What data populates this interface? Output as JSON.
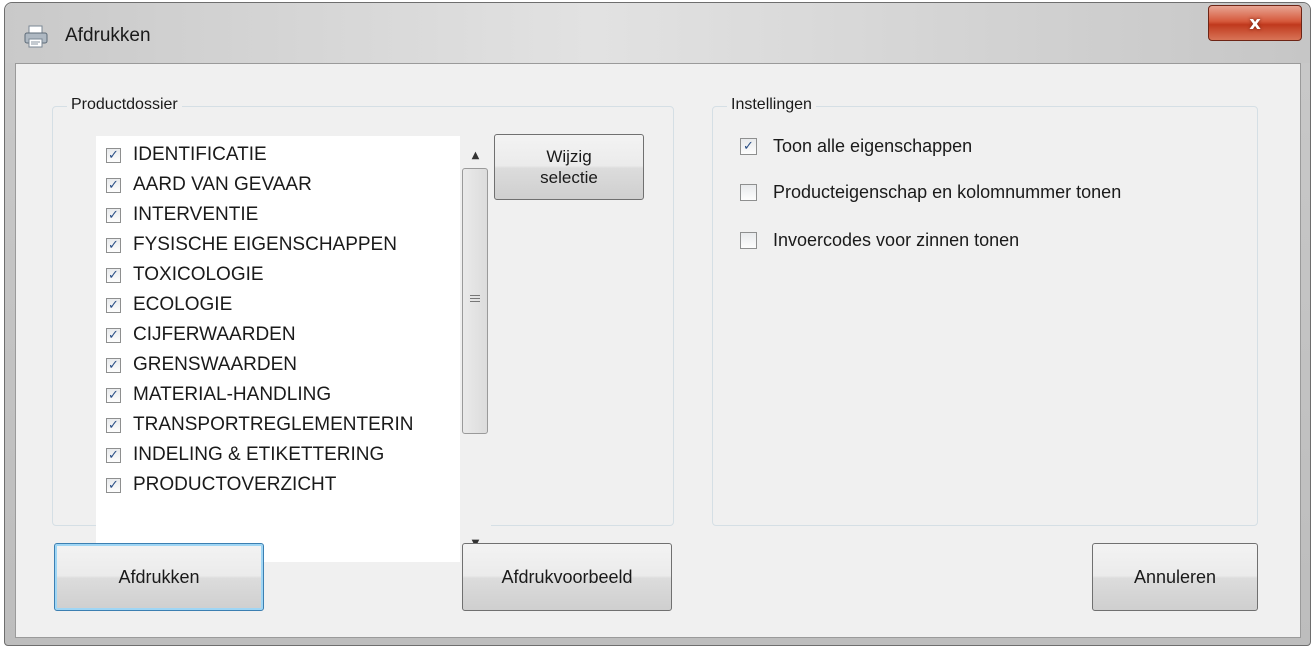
{
  "window": {
    "title": "Afdrukken",
    "close_label": "x",
    "icon": "printer-icon"
  },
  "productdossier": {
    "label": "Productdossier",
    "items": [
      {
        "label": "IDENTIFICATIE",
        "checked": true
      },
      {
        "label": "AARD VAN GEVAAR",
        "checked": true
      },
      {
        "label": "INTERVENTIE",
        "checked": true
      },
      {
        "label": "FYSISCHE EIGENSCHAPPEN",
        "checked": true
      },
      {
        "label": "TOXICOLOGIE",
        "checked": true
      },
      {
        "label": "ECOLOGIE",
        "checked": true
      },
      {
        "label": "CIJFERWAARDEN",
        "checked": true
      },
      {
        "label": "GRENSWAARDEN",
        "checked": true
      },
      {
        "label": "MATERIAL-HANDLING",
        "checked": true
      },
      {
        "label": "TRANSPORTREGLEMENTERIN",
        "checked": true
      },
      {
        "label": "INDELING & ETIKETTERING",
        "checked": true
      },
      {
        "label": "PRODUCTOVERZICHT",
        "checked": true
      }
    ],
    "wijzig_line1": "Wijzig",
    "wijzig_line2": "selectie"
  },
  "instellingen": {
    "label": "Instellingen",
    "options": [
      {
        "label": "Toon alle eigenschappen",
        "checked": true
      },
      {
        "label": "Producteigenschap en kolomnummer tonen",
        "checked": false
      },
      {
        "label": "Invoercodes voor zinnen tonen",
        "checked": false
      }
    ]
  },
  "buttons": {
    "print": "Afdrukken",
    "preview": "Afdrukvoorbeeld",
    "cancel": "Annuleren"
  },
  "check_glyph": "✓"
}
